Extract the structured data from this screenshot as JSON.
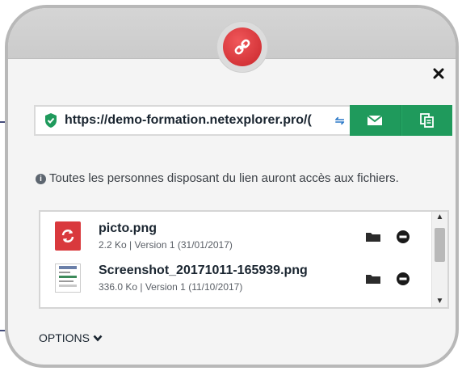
{
  "share_dialog": {
    "url": {
      "value": "https://demo-formation.netexplorer.pro/("
    },
    "info": {
      "text": "Toutes les personnes disposant du lien auront accès aux fichiers."
    },
    "files": [
      {
        "name": "picto.png",
        "meta": "2.2 Ko | Version 1 (31/01/2017)",
        "icon": "refresh-sync-icon"
      },
      {
        "name": "Screenshot_20171011-165939.png",
        "meta": "336.0 Ko | Version 1 (11/10/2017)",
        "icon": "screenshot-thumbnail"
      }
    ],
    "options_label": "OPTIONS",
    "colors": {
      "accent_green": "#1f9a5c",
      "badge_red": "#d9393d",
      "callout_line": "#444c7a"
    },
    "icons": {
      "header": "link-icon",
      "close": "close-icon",
      "secure": "shield-check-icon",
      "mail": "envelope-icon",
      "copy": "copy-icon",
      "folder": "folder-icon",
      "remove": "minus-circle-icon",
      "options": "chevron-down-icon"
    }
  }
}
